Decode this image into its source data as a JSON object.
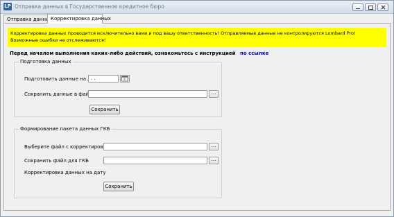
{
  "window": {
    "logo_text": "LP",
    "title": "Отправка данных в Государственное кредитное бюро"
  },
  "tabs": [
    {
      "label": "Отправка данных",
      "active": false
    },
    {
      "label": "Корректировка данных",
      "active": true
    }
  ],
  "warning": {
    "text": "Корректировка данных проводится исключительно вами и под вашу ответственность! Отправляемые данные не контролируются Lombard Pro! Возможные ошибки не отслеживаются!",
    "color": "#ffff00"
  },
  "instruction": {
    "text": "Перед началом выполнения каких-либо действий, ознакомьтесь с инструкцией",
    "link": "по ссылке",
    "link_color": "#0000cc"
  },
  "prepare_group": {
    "legend": "Подготовка данных",
    "date_label": "Подготовить данные на дату",
    "date_value": " . .",
    "file_label": "Сохранить данные в файл",
    "file_value": "",
    "browse_label": "...",
    "save_label": "Сохранить"
  },
  "package_group": {
    "legend": "Формирование пакета данных ГКБ",
    "corrections_label": "Выберите файл с корректировками",
    "corrections_value": "",
    "gkb_label": "Сохранить файл для ГКБ",
    "gkb_value": "",
    "date_label": "Корректировка данных на дату",
    "browse_label": "...",
    "save_label": "Сохранить"
  }
}
